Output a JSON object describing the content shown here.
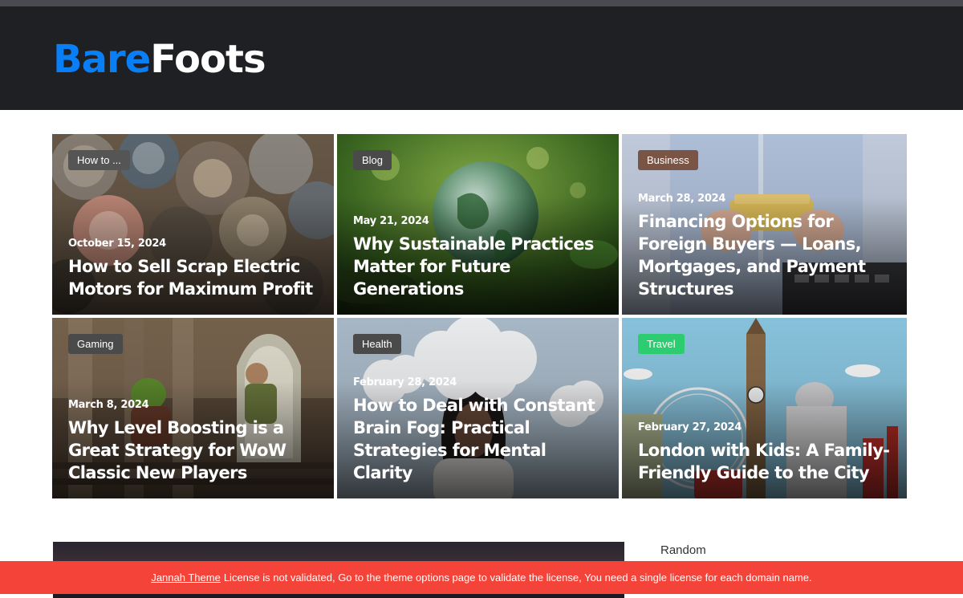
{
  "site": {
    "logo_part1": "Bare",
    "logo_part2": "Foots"
  },
  "posts": [
    {
      "category": "How to ...",
      "category_color": "#555555",
      "date": "October 15, 2024",
      "title": "How to Sell Scrap Electric Motors for Maximum Profit",
      "image": "scrap-electric-motors-photo"
    },
    {
      "category": "Blog",
      "category_color": "#4a4a4a",
      "date": "May 21, 2024",
      "title": "Why Sustainable Practices Matter for Future Generations",
      "image": "glass-globe-in-greenery-photo"
    },
    {
      "category": "Business",
      "category_color": "#7a5444",
      "date": "March 28, 2024",
      "title": "Financing Options for Foreign Buyers — Loans, Mortgages, and Payment Structures",
      "image": "house-model-calculator-photo"
    },
    {
      "category": "Gaming",
      "category_color": "#4a4a4a",
      "date": "March 8, 2024",
      "title": "Why Level Boosting is a Great Strategy for WoW Classic New Players",
      "image": "fantasy-game-art"
    },
    {
      "category": "Health",
      "category_color": "#4a4a4a",
      "date": "February 28, 2024",
      "title": "How to Deal with Constant Brain Fog: Practical Strategies for Mental Clarity",
      "image": "woman-with-cloud-head-photo"
    },
    {
      "category": "Travel",
      "category_color": "#2ecc71",
      "date": "February 27, 2024",
      "title": "London with Kids: A Family-Friendly Guide to the City",
      "image": "london-illustration"
    }
  ],
  "sidebar": {
    "tab_label": "Random"
  },
  "notice": {
    "link_text": "Jannah Theme",
    "message": "License is not validated, Go to the theme options page to validate the license, You need a single license for each domain name."
  }
}
